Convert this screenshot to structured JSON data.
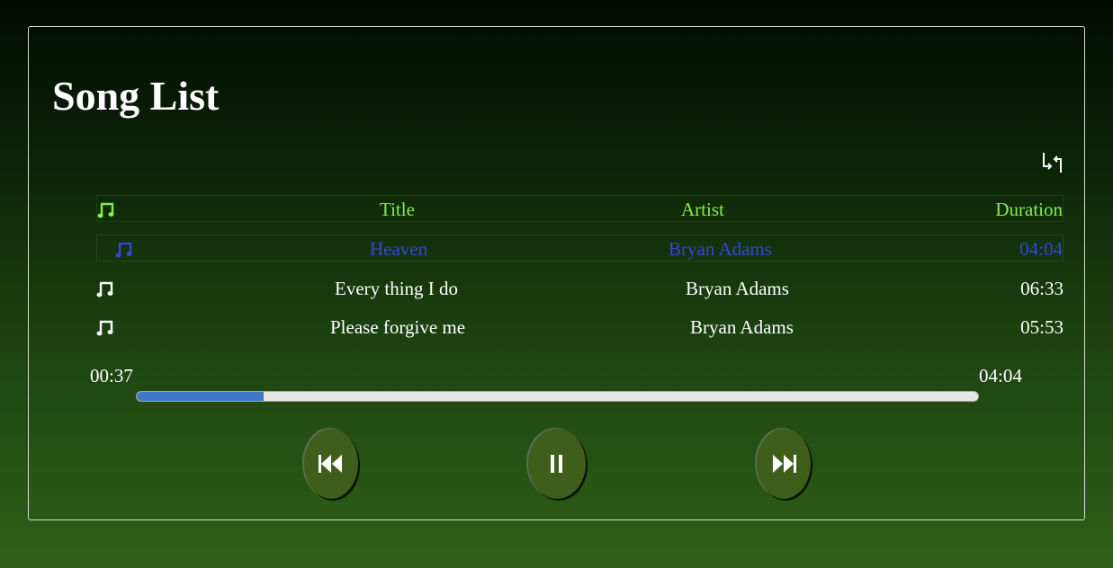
{
  "page": {
    "title": "Song List"
  },
  "icons": {
    "repeat": "repeat-icon",
    "note": "music-note-icon",
    "previous": "skip-previous-icon",
    "pause": "pause-icon",
    "next": "skip-next-icon"
  },
  "colors": {
    "header_text": "#86ee4a",
    "active_text": "#3445d8",
    "text": "#ffffff",
    "progress_fill": "#3f78c8",
    "button": "#3e5f1c"
  },
  "table": {
    "headers": {
      "title": "Title",
      "artist": "Artist",
      "duration": "Duration"
    },
    "songs": [
      {
        "title": "Heaven",
        "artist": "Bryan Adams",
        "duration": "04:04",
        "active": true
      },
      {
        "title": "Every thing I do",
        "artist": "Bryan Adams",
        "duration": "06:33",
        "active": false
      },
      {
        "title": "Please forgive me",
        "artist": "Bryan Adams",
        "duration": "05:53",
        "active": false
      }
    ]
  },
  "player": {
    "current_time": "00:37",
    "total_time": "04:04",
    "progress_fraction": 0.151,
    "state": "playing"
  }
}
